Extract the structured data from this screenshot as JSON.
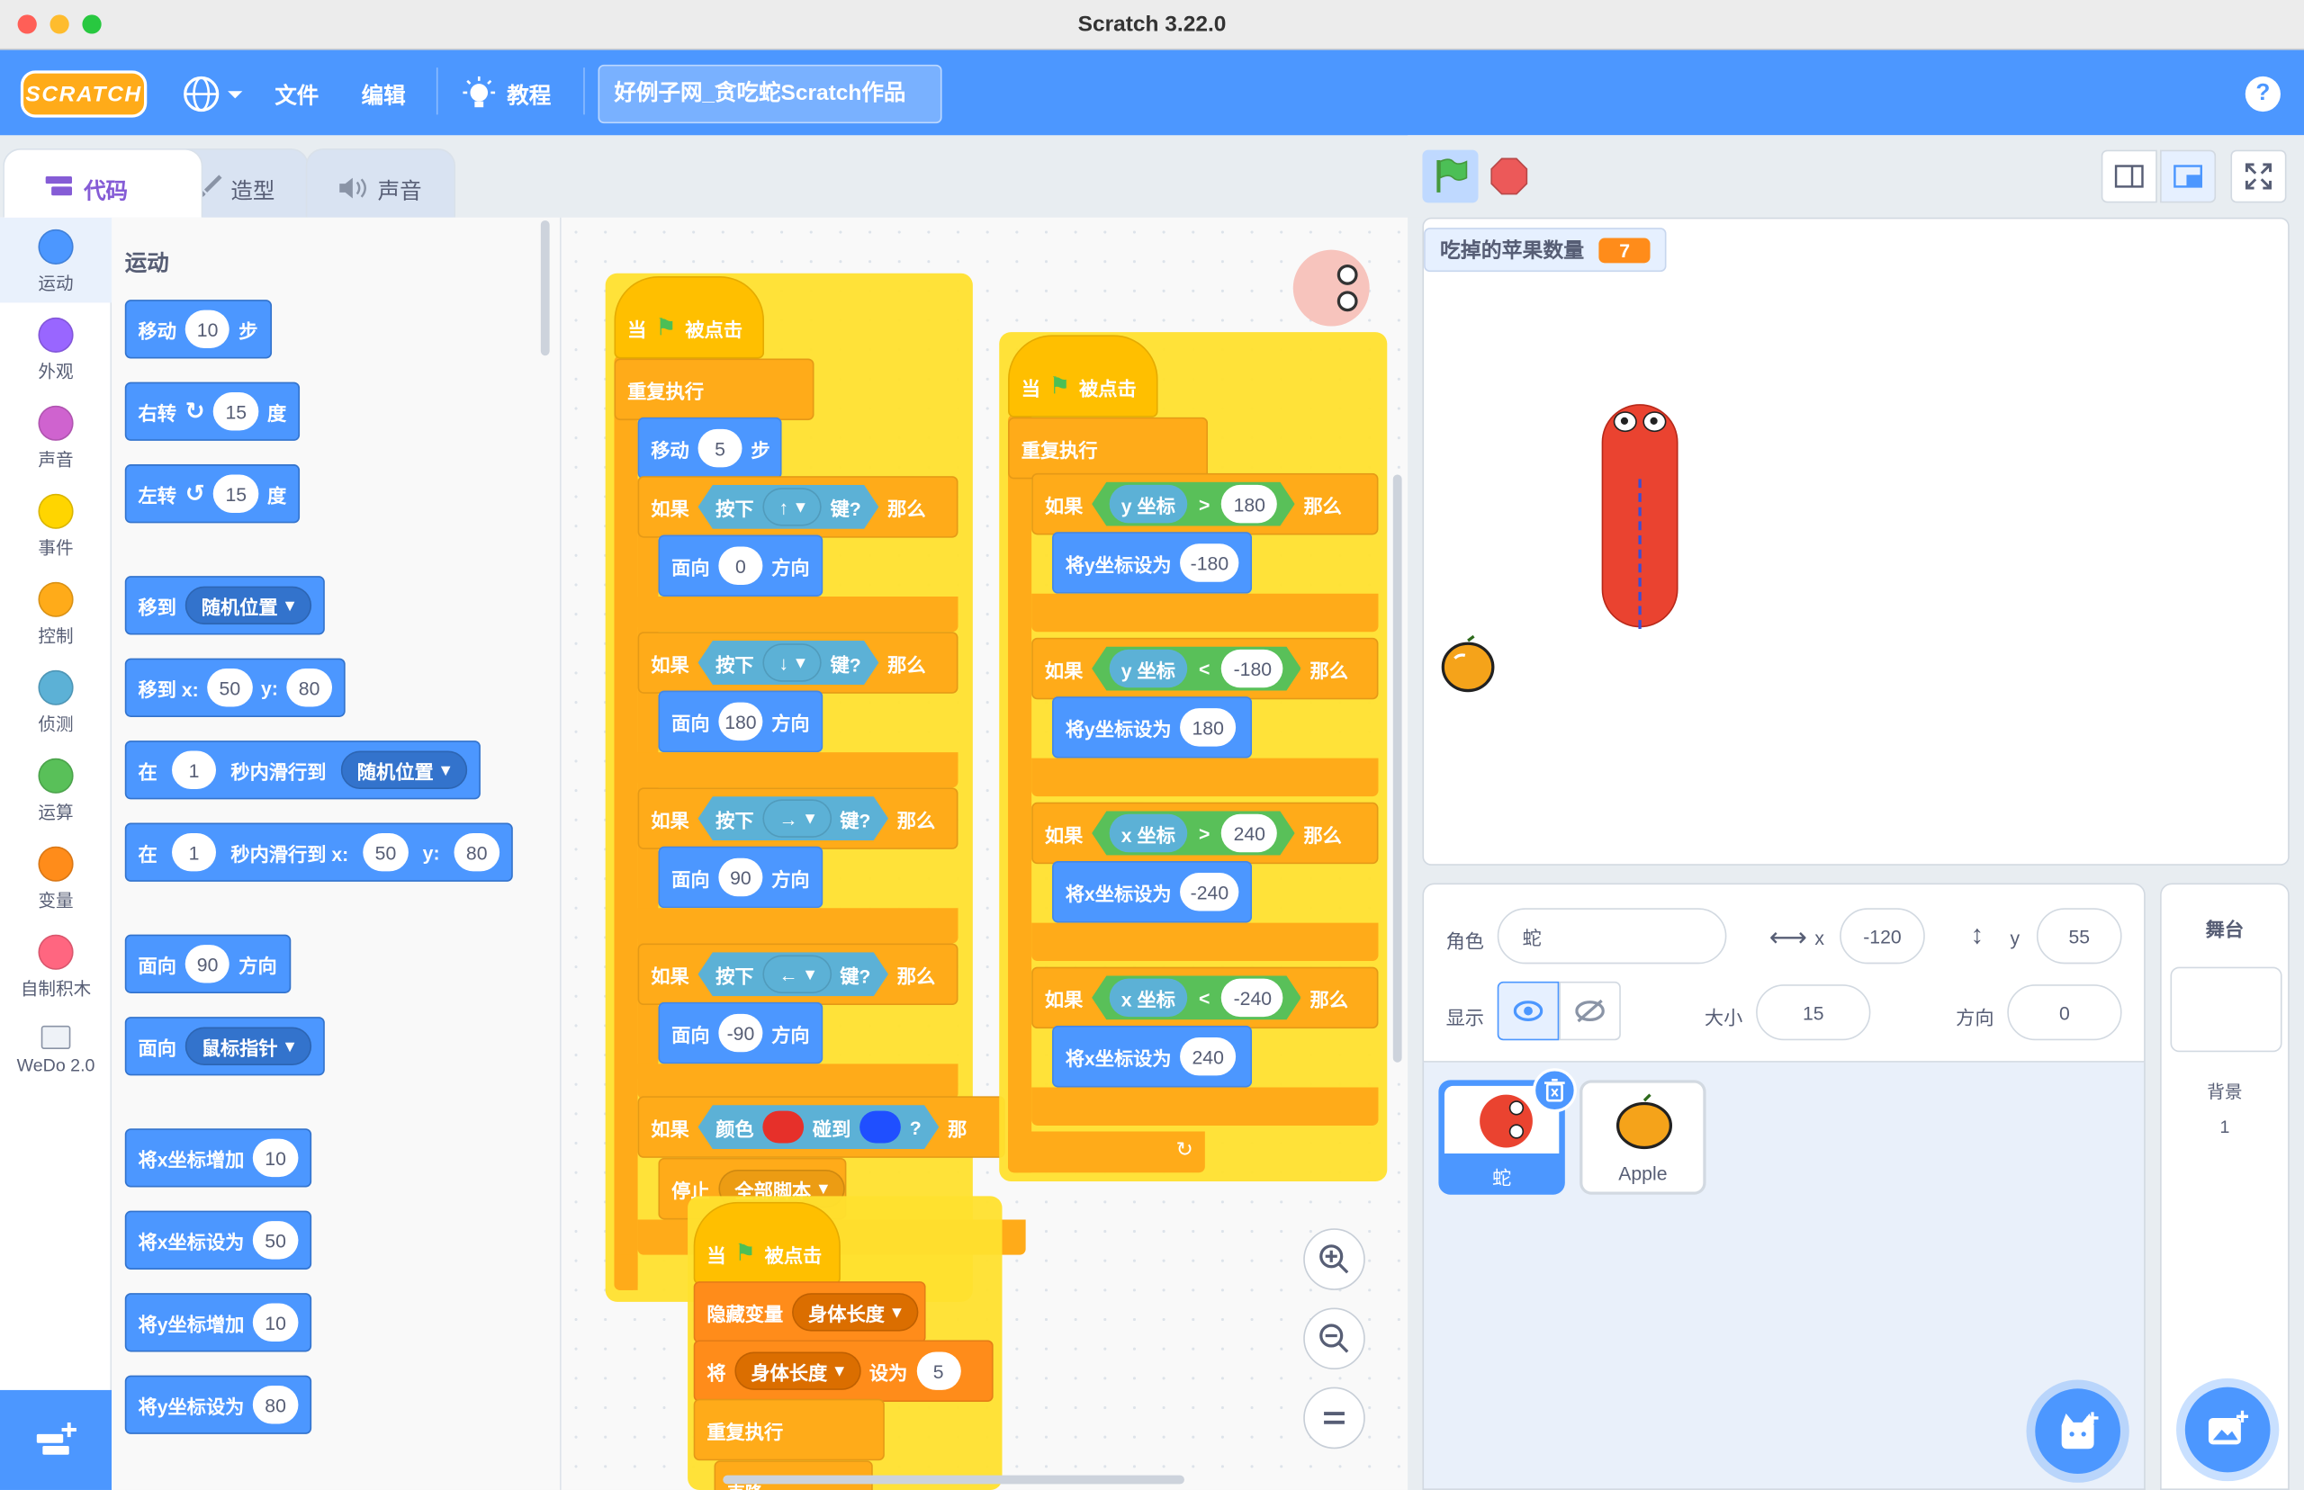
{
  "window": {
    "title": "Scratch 3.22.0"
  },
  "menubar": {
    "logo": "SCRATCH",
    "file": "文件",
    "edit": "编辑",
    "tutorials": "教程",
    "project_title": "好例子网_贪吃蛇Scratch作品",
    "help": "?"
  },
  "tabs": {
    "code": "代码",
    "costumes": "造型",
    "sounds": "声音"
  },
  "categories": [
    {
      "label": "运动",
      "color": "#4c97ff"
    },
    {
      "label": "外观",
      "color": "#9966ff"
    },
    {
      "label": "声音",
      "color": "#cf63cf"
    },
    {
      "label": "事件",
      "color": "#ffd500"
    },
    {
      "label": "控制",
      "color": "#ffab19"
    },
    {
      "label": "侦测",
      "color": "#5cb1d6"
    },
    {
      "label": "运算",
      "color": "#59c059"
    },
    {
      "label": "变量",
      "color": "#ff8c1a"
    },
    {
      "label": "自制积木",
      "color": "#ff6680"
    },
    {
      "label": "WeDo 2.0",
      "color": "#ffffff"
    }
  ],
  "palette": {
    "section": "运动",
    "move": {
      "a": "移动",
      "v": "10",
      "b": "步"
    },
    "turn_right": {
      "a": "右转",
      "v": "15",
      "b": "度"
    },
    "turn_left": {
      "a": "左转",
      "v": "15",
      "b": "度"
    },
    "goto": {
      "a": "移到",
      "d": "随机位置"
    },
    "goto_xy": {
      "a": "移到 x:",
      "x": "50",
      "b": "y:",
      "y": "80"
    },
    "glide": {
      "a": "在",
      "v": "1",
      "b": "秒内滑行到",
      "d": "随机位置"
    },
    "glide_xy": {
      "a": "在",
      "v": "1",
      "b": "秒内滑行到 x:",
      "x": "50",
      "c": "y:",
      "y": "80"
    },
    "point": {
      "a": "面向",
      "v": "90",
      "b": "方向"
    },
    "point_towards": {
      "a": "面向",
      "d": "鼠标指针"
    },
    "change_x": {
      "a": "将x坐标增加",
      "v": "10"
    },
    "set_x": {
      "a": "将x坐标设为",
      "v": "50"
    },
    "change_y": {
      "a": "将y坐标增加",
      "v": "10"
    },
    "set_y": {
      "a": "将y坐标设为",
      "v": "80"
    }
  },
  "script1": {
    "hat_a": "当",
    "hat_b": "被点击",
    "forever": "重复执行",
    "move_a": "移动",
    "move_v": "5",
    "move_b": "步",
    "if": "如果",
    "then": "那么",
    "press": "按下",
    "key": "键?",
    "face": "面向",
    "dir": "方向",
    "k_up": "↑",
    "d_up": "0",
    "k_down": "↓",
    "d_down": "180",
    "k_right": "→",
    "d_right": "90",
    "k_left": "←",
    "d_left": "-90",
    "color": "颜色",
    "touch": "碰到",
    "q": "?",
    "then_cut": "那",
    "stop": "停止",
    "stop_opt": "全部脚本"
  },
  "script2": {
    "hat_a": "当",
    "hat_b": "被点击",
    "forever": "重复执行",
    "if": "如果",
    "then": "那么",
    "ypos": "y 坐标",
    "xpos": "x 坐标",
    "gt": ">",
    "lt": "<",
    "v180": "180",
    "vm180": "-180",
    "v240": "240",
    "vm240": "-240",
    "sety": "将y坐标设为",
    "setx": "将x坐标设为",
    "sety_v1": "-180",
    "sety_v2": "180",
    "setx_v1": "-240",
    "setx_v2": "240"
  },
  "script3": {
    "hat_a": "当",
    "hat_b": "被点击",
    "hide": "隐藏变量",
    "var": "身体长度",
    "set": "将",
    "to": "设为",
    "val": "5",
    "forever": "重复执行",
    "cut": "克隆"
  },
  "stage": {
    "monitor_label": "吃掉的苹果数量",
    "monitor_value": "7"
  },
  "sprite_info": {
    "sprite_label": "角色",
    "sprite_name": "蛇",
    "x_label": "x",
    "x": "-120",
    "y_label": "y",
    "y": "55",
    "show_label": "显示",
    "size_label": "大小",
    "size": "15",
    "dir_label": "方向",
    "dir": "0"
  },
  "sprites": [
    {
      "name": "蛇",
      "selected": true
    },
    {
      "name": "Apple",
      "selected": false
    }
  ],
  "stage_panel": {
    "title": "舞台",
    "backdrops_label": "背景",
    "backdrops_count": "1"
  }
}
